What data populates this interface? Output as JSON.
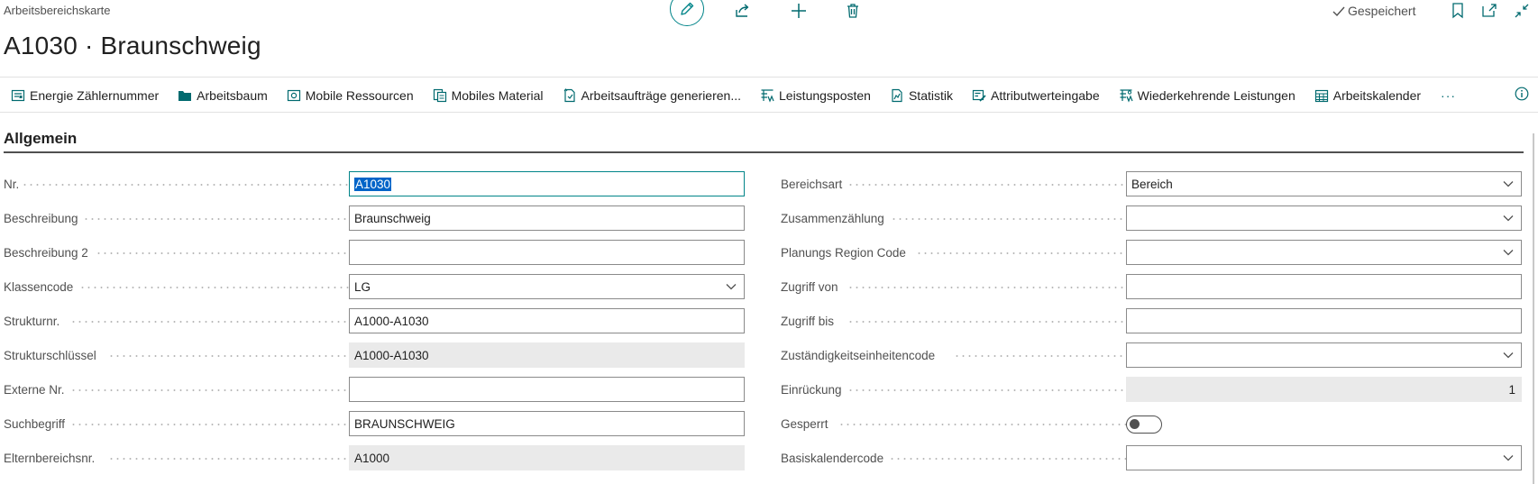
{
  "header": {
    "caption": "Arbeitsbereichskarte",
    "title": "A1030 · Braunschweig",
    "saved_label": "Gespeichert"
  },
  "ribbon": [
    {
      "label": "Energie Zählernummer",
      "icon": "meter-icon"
    },
    {
      "label": "Arbeitsbaum",
      "icon": "folder-icon"
    },
    {
      "label": "Mobile Ressourcen",
      "icon": "resources-icon"
    },
    {
      "label": "Mobiles Material",
      "icon": "material-icon"
    },
    {
      "label": "Arbeitsaufträge generieren...",
      "icon": "generate-icon"
    },
    {
      "label": "Leistungsposten",
      "icon": "entries-icon"
    },
    {
      "label": "Statistik",
      "icon": "statistics-icon"
    },
    {
      "label": "Attributwerteingabe",
      "icon": "attribute-icon"
    },
    {
      "label": "Wiederkehrende Leistungen",
      "icon": "recurring-icon"
    },
    {
      "label": "Arbeitskalender",
      "icon": "calendar-icon"
    }
  ],
  "ribbon_more": "···",
  "section": {
    "title": "Allgemein"
  },
  "left_fields": [
    {
      "label": "Nr.",
      "value": "A1030",
      "kind": "input-focused"
    },
    {
      "label": "Beschreibung",
      "value": "Braunschweig",
      "kind": "input"
    },
    {
      "label": "Beschreibung 2",
      "value": "",
      "kind": "input"
    },
    {
      "label": "Klassencode",
      "value": "LG",
      "kind": "select"
    },
    {
      "label": "Strukturnr.",
      "value": "A1000-A1030",
      "kind": "input"
    },
    {
      "label": "Strukturschlüssel",
      "value": "A1000-A1030",
      "kind": "readonly"
    },
    {
      "label": "Externe Nr.",
      "value": "",
      "kind": "input"
    },
    {
      "label": "Suchbegriff",
      "value": "BRAUNSCHWEIG",
      "kind": "input"
    },
    {
      "label": "Elternbereichsnr.",
      "value": "A1000",
      "kind": "readonly"
    }
  ],
  "right_fields": [
    {
      "label": "Bereichsart",
      "value": "Bereich",
      "kind": "select"
    },
    {
      "label": "Zusammenzählung",
      "value": "",
      "kind": "select"
    },
    {
      "label": "Planungs Region Code",
      "value": "",
      "kind": "select"
    },
    {
      "label": "Zugriff von",
      "value": "",
      "kind": "input"
    },
    {
      "label": "Zugriff bis",
      "value": "",
      "kind": "input"
    },
    {
      "label": "Zuständigkeitseinheitencode",
      "value": "",
      "kind": "select"
    },
    {
      "label": "Einrückung",
      "value": "1",
      "kind": "readonly-right"
    },
    {
      "label": "Gesperrt",
      "value": "",
      "kind": "toggle"
    },
    {
      "label": "Basiskalendercode",
      "value": "",
      "kind": "select"
    }
  ],
  "colors": {
    "accent": "#008489",
    "selection": "#0064c8"
  }
}
